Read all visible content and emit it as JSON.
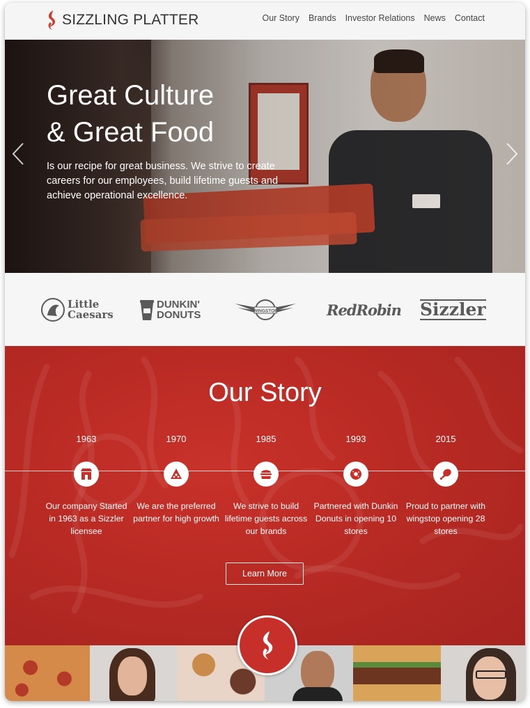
{
  "header": {
    "logo_text": "SIZZLING PLATTER",
    "nav": [
      "Our Story",
      "Brands",
      "Investor Relations",
      "News",
      "Contact"
    ]
  },
  "hero": {
    "title_line1": "Great Culture",
    "title_line2": "& Great Food",
    "body": "Is our recipe for great business. We strive to create careers for our employees, build lifetime guests and achieve operational excellence."
  },
  "brands": {
    "little_caesars": [
      "Little",
      "Caesars"
    ],
    "dunkin": [
      "DUNKIN'",
      "DONUTS"
    ],
    "wingstop": "WINGSTOP",
    "red_robin": "RedRobin",
    "sizzler": "Sizzler"
  },
  "story": {
    "title": "Our Story",
    "timeline": [
      {
        "year": "1963",
        "text": "Our company Started in 1963 as a Sizzler licensee",
        "icon": "restaurant-icon"
      },
      {
        "year": "1970",
        "text": "We are the preferred partner for high growth",
        "icon": "pizza-slice-icon"
      },
      {
        "year": "1985",
        "text": "We strive to build lifetime guests across our brands",
        "icon": "burger-icon"
      },
      {
        "year": "1993",
        "text": "Partnered with Dunkin Donuts in opening 10 stores",
        "icon": "donut-icon"
      },
      {
        "year": "2015",
        "text": "Proud to partner with wingstop opening 28 stores",
        "icon": "chicken-leg-icon"
      }
    ],
    "cta": "Learn More"
  },
  "colors": {
    "brand_red": "#c7302a",
    "header_bg": "#f5f5f5",
    "text_dark": "#333333"
  }
}
